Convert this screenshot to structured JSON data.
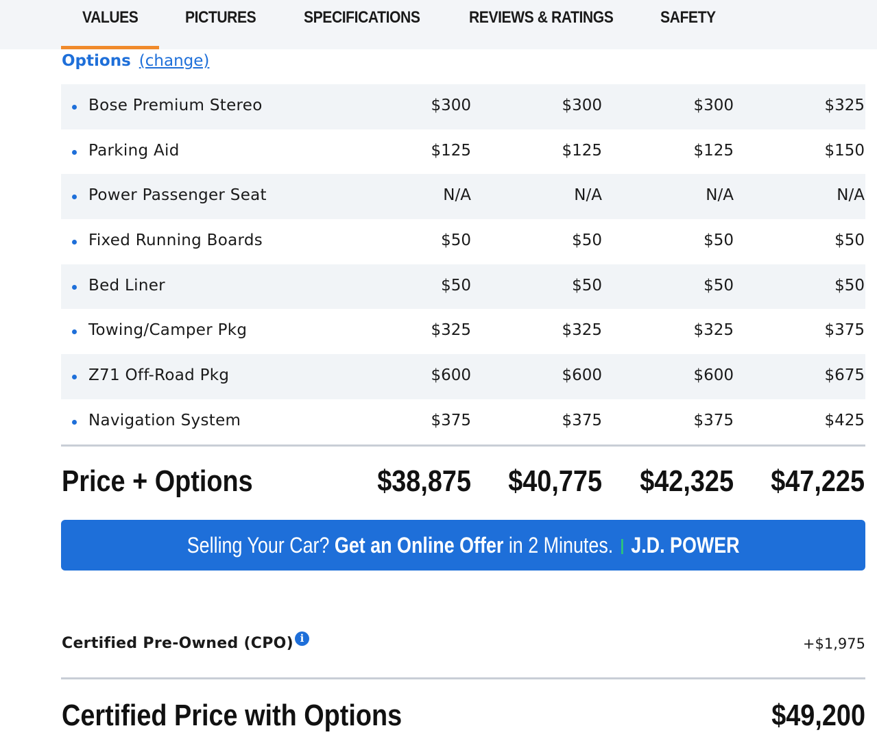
{
  "nav": {
    "tabs": [
      {
        "label": "VALUES",
        "active": true
      },
      {
        "label": "PICTURES"
      },
      {
        "label": "SPECIFICATIONS"
      },
      {
        "label": "REVIEWS & RATINGS"
      },
      {
        "label": "SAFETY"
      }
    ]
  },
  "options": {
    "heading": "Options",
    "change_link": "(change)",
    "rows": [
      {
        "label": "Bose Premium Stereo",
        "values": [
          "$300",
          "$300",
          "$300",
          "$325"
        ]
      },
      {
        "label": "Parking Aid",
        "values": [
          "$125",
          "$125",
          "$125",
          "$150"
        ]
      },
      {
        "label": "Power Passenger Seat",
        "values": [
          "N/A",
          "N/A",
          "N/A",
          "N/A"
        ]
      },
      {
        "label": "Fixed Running Boards",
        "values": [
          "$50",
          "$50",
          "$50",
          "$50"
        ]
      },
      {
        "label": "Bed Liner",
        "values": [
          "$50",
          "$50",
          "$50",
          "$50"
        ]
      },
      {
        "label": "Towing/Camper Pkg",
        "values": [
          "$325",
          "$325",
          "$325",
          "$375"
        ]
      },
      {
        "label": "Z71 Off-Road Pkg",
        "values": [
          "$600",
          "$600",
          "$600",
          "$675"
        ]
      },
      {
        "label": "Navigation System",
        "values": [
          "$375",
          "$375",
          "$375",
          "$425"
        ]
      }
    ]
  },
  "totals": {
    "label": "Price + Options",
    "values": [
      "$38,875",
      "$40,775",
      "$42,325",
      "$47,225"
    ]
  },
  "banner": {
    "part1": "Selling Your Car? ",
    "bold": "Get an Online Offer",
    "part2": " in 2 Minutes.",
    "brand": "J.D. POWER",
    "color": "#1e6fd9",
    "separator_color": "#2ecc71"
  },
  "cpo": {
    "label": "Certified Pre-Owned (CPO)",
    "info_icon": "info-icon",
    "value": "+$1,975"
  },
  "final": {
    "label": "Certified Price with Options",
    "value": "$49,200"
  },
  "colors": {
    "accent": "#1e6fd9",
    "tab_underline": "#f08a2c",
    "row_alt": "#f1f4f7"
  }
}
